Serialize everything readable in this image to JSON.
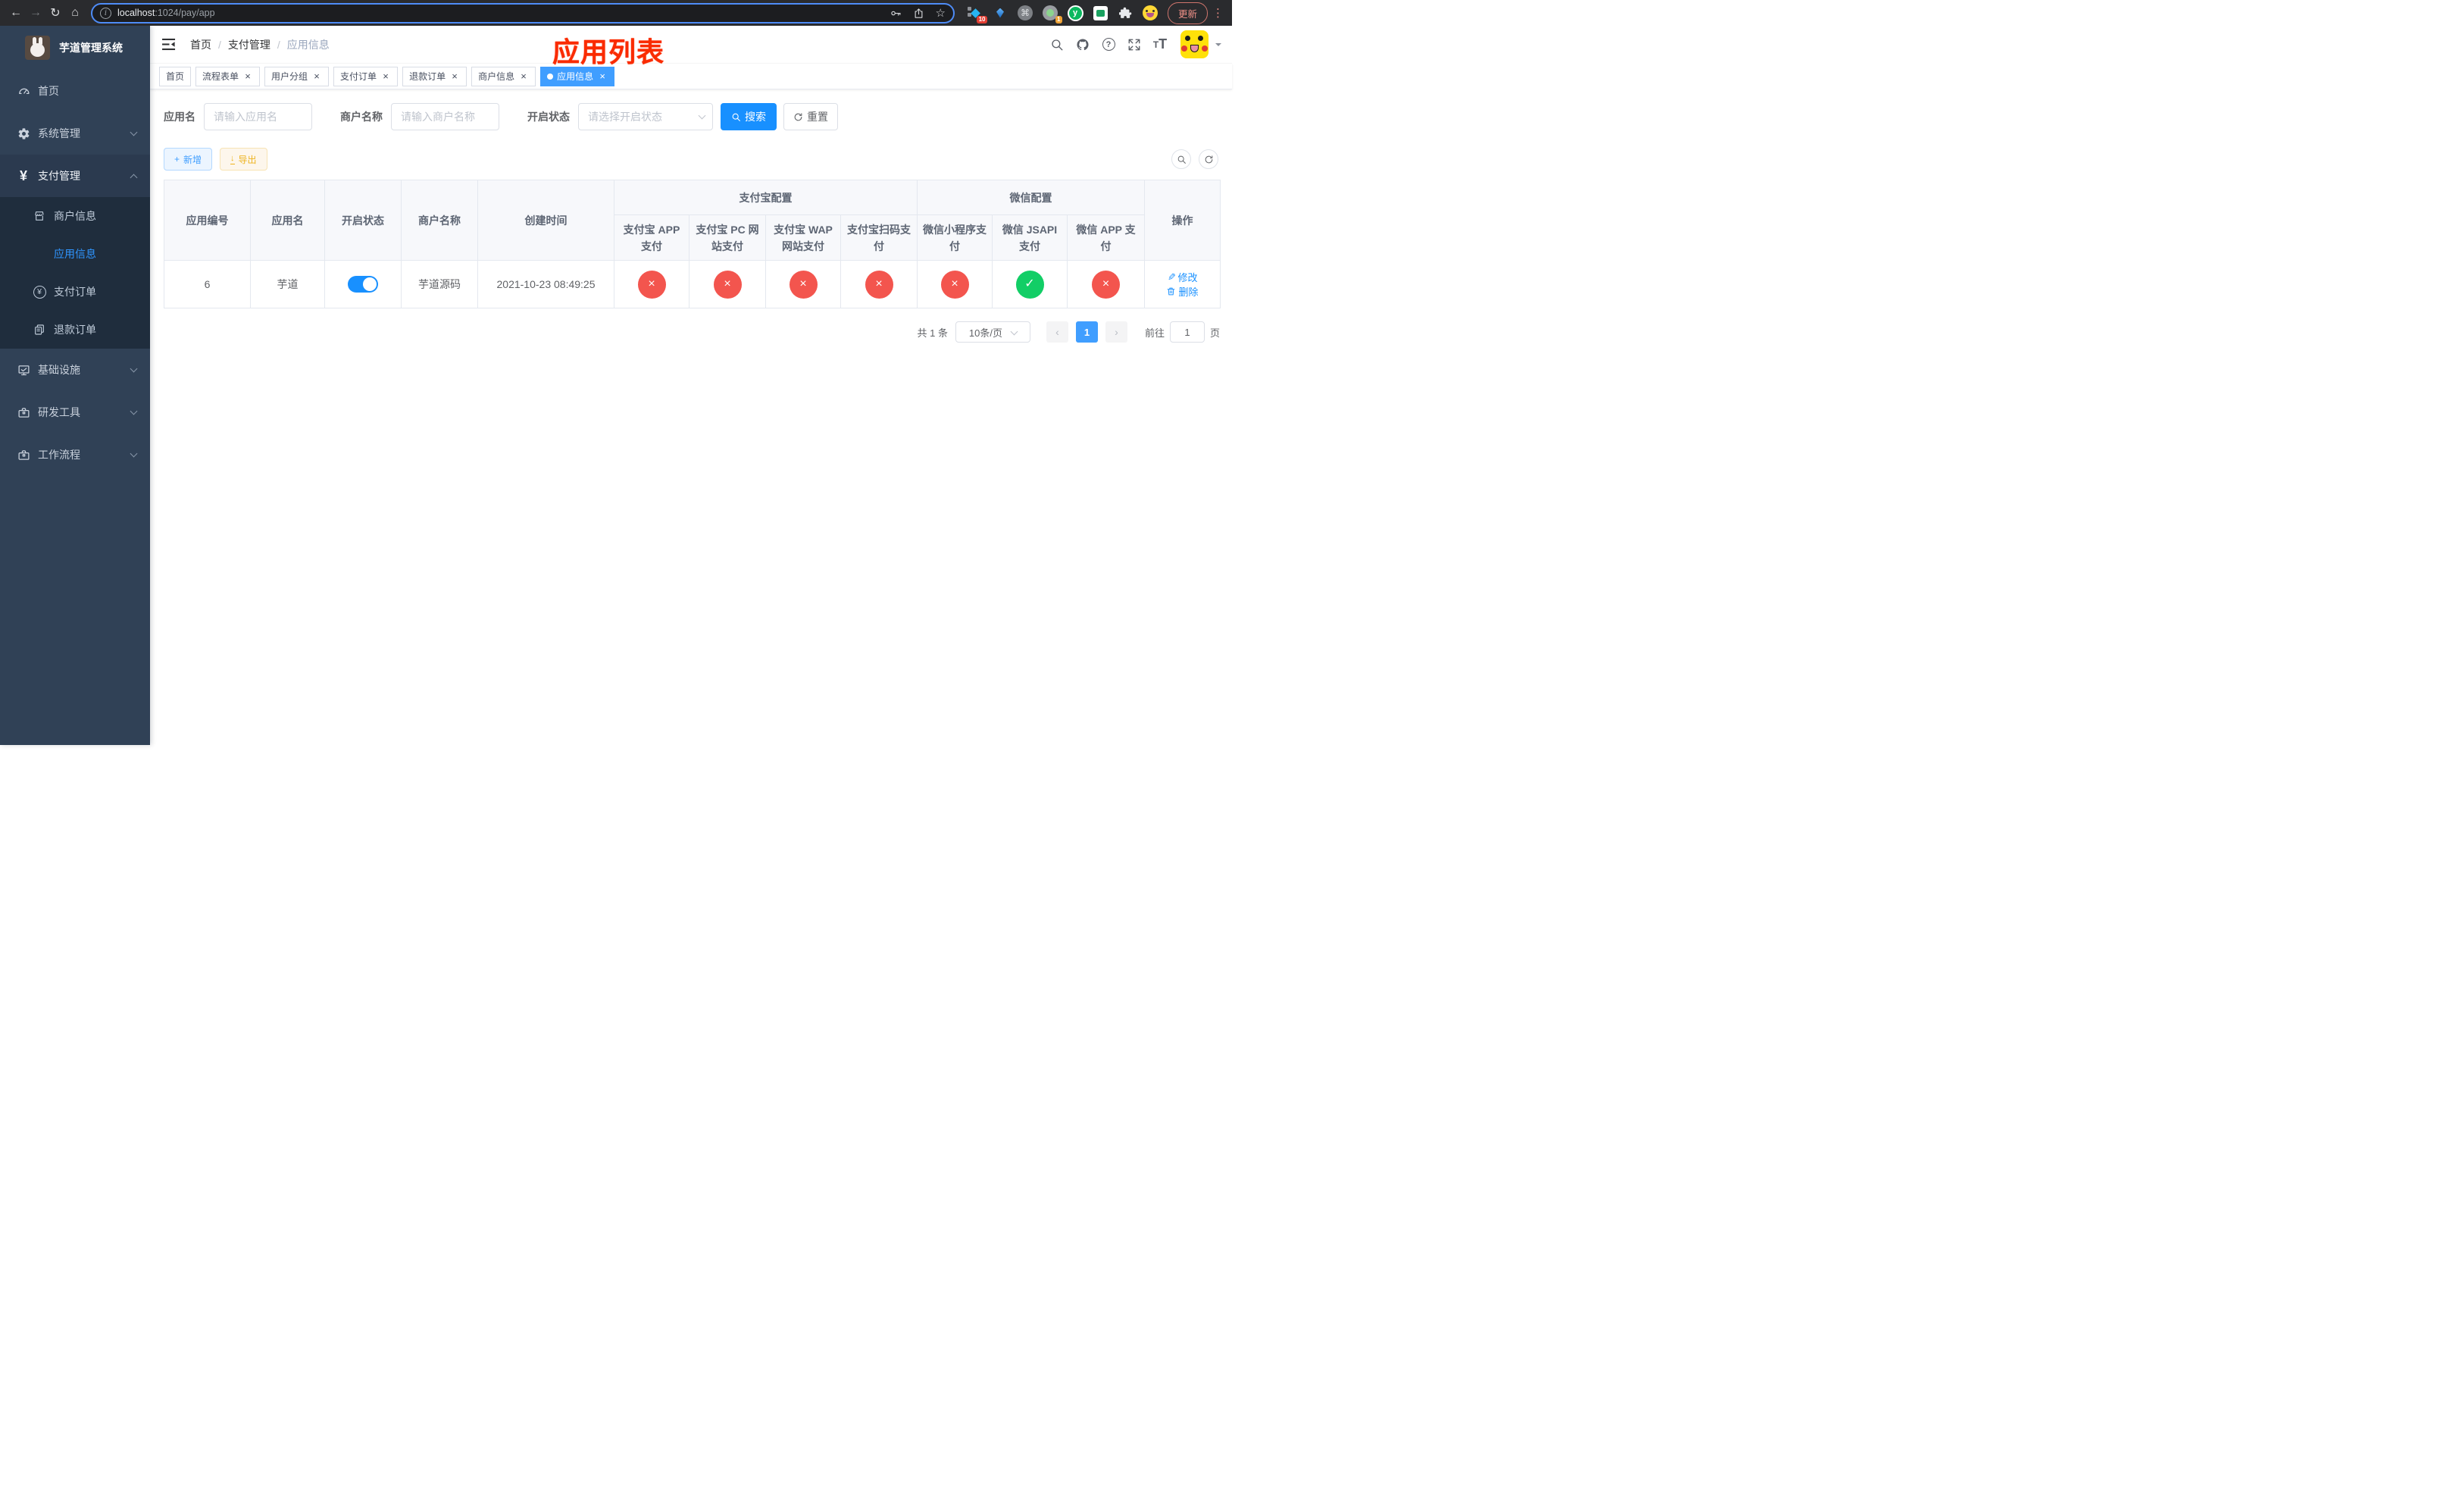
{
  "browser": {
    "url_host": "localhost",
    "url_path": ":1024/pay/app",
    "ext_badge_blue": "10",
    "ext_badge_recorder": "1",
    "update_label": "更新"
  },
  "sidebar": {
    "title": "芋道管理系统",
    "menu": [
      {
        "label": "首页"
      },
      {
        "label": "系统管理"
      },
      {
        "label": "支付管理"
      },
      {
        "label": "基础设施"
      },
      {
        "label": "研发工具"
      },
      {
        "label": "工作流程"
      }
    ],
    "submenu": [
      {
        "label": "商户信息"
      },
      {
        "label": "应用信息"
      },
      {
        "label": "支付订单"
      },
      {
        "label": "退款订单"
      }
    ]
  },
  "navbar": {
    "breadcrumb": [
      "首页",
      "支付管理",
      "应用信息"
    ]
  },
  "overlay_title": "应用列表",
  "tags": [
    {
      "label": "首页"
    },
    {
      "label": "流程表单"
    },
    {
      "label": "用户分组"
    },
    {
      "label": "支付订单"
    },
    {
      "label": "退款订单"
    },
    {
      "label": "商户信息"
    },
    {
      "label": "应用信息"
    }
  ],
  "filters": {
    "app_name_label": "应用名",
    "app_name_placeholder": "请输入应用名",
    "merchant_label": "商户名称",
    "merchant_placeholder": "请输入商户名称",
    "status_label": "开启状态",
    "status_placeholder": "请选择开启状态",
    "search_label": "搜索",
    "reset_label": "重置"
  },
  "toolbar": {
    "add_label": "新增",
    "export_label": "导出"
  },
  "table": {
    "columns": [
      "应用编号",
      "应用名",
      "开启状态",
      "商户名称",
      "创建时间"
    ],
    "groups": {
      "alipay": "支付宝配置",
      "wechat": "微信配置",
      "actions": "操作"
    },
    "sub_columns": [
      "支付宝 APP 支付",
      "支付宝 PC 网站支付",
      "支付宝 WAP 网站支付",
      "支付宝扫码支付",
      "微信小程序支付",
      "微信 JSAPI 支付",
      "微信 APP 支付"
    ],
    "row": {
      "id": "6",
      "name": "芋道",
      "enabled": true,
      "merchant": "芋道源码",
      "created_at": "2021-10-23 08:49:25",
      "statuses": [
        "no",
        "no",
        "no",
        "no",
        "no",
        "yes",
        "no"
      ],
      "edit_label": "修改",
      "delete_label": "删除"
    }
  },
  "pagination": {
    "total": "共 1 条",
    "page_size": "10条/页",
    "current_page": "1",
    "goto_label": "前往",
    "goto_value": "1",
    "page_unit": "页"
  },
  "colors": {
    "primary": "#1890ff",
    "active_tag": "#409eff",
    "danger": "#f3554e",
    "success": "#12ce66",
    "sidebar_bg": "#304156",
    "submenu_bg": "#1f2d3d",
    "annotation_red": "#fa2b00"
  }
}
